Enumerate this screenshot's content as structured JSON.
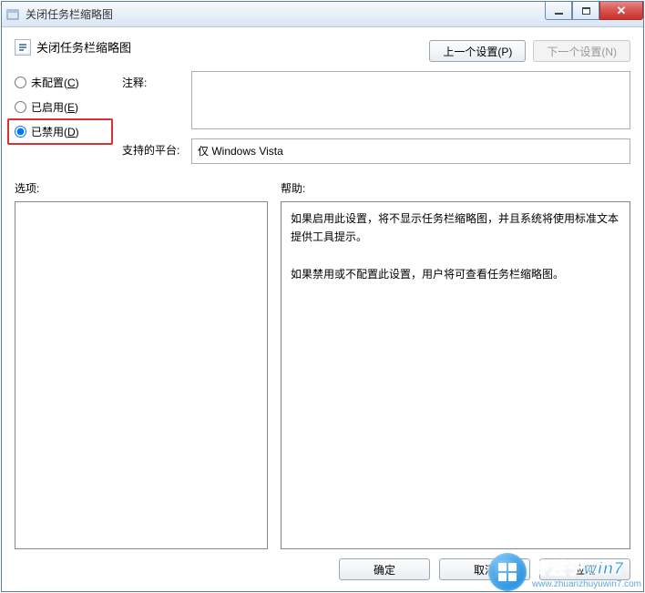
{
  "window": {
    "title": "关闭任务栏缩略图"
  },
  "header": {
    "title": "关闭任务栏缩略图"
  },
  "nav": {
    "prev_label": "上一个设置(P)",
    "prev_accesskey": "P",
    "next_label": "下一个设置(N)",
    "next_accesskey": "N",
    "next_enabled": false
  },
  "radios": {
    "not_configured": {
      "label": "未配置(C)",
      "accesskey": "C",
      "checked": false
    },
    "enabled": {
      "label": "已启用(E)",
      "accesskey": "E",
      "checked": false
    },
    "disabled": {
      "label": "已禁用(D)",
      "accesskey": "D",
      "checked": true
    }
  },
  "fields": {
    "comment_label": "注释:",
    "comment_value": "",
    "platform_label": "支持的平台:",
    "platform_value": "仅 Windows Vista"
  },
  "columns": {
    "options_label": "选项:",
    "help_label": "帮助:"
  },
  "help": {
    "p1": "如果启用此设置，将不显示任务栏缩略图，并且系统将使用标准文本提供工具提示。",
    "p2": "如果禁用或不配置此设置，用户将可查看任务栏缩略图。"
  },
  "actions": {
    "ok": "确定",
    "cancel": "取消",
    "apply": "应用"
  },
  "watermark": {
    "title": "专注于win7",
    "url": "www.zhuanzhuyuwin7.com"
  }
}
